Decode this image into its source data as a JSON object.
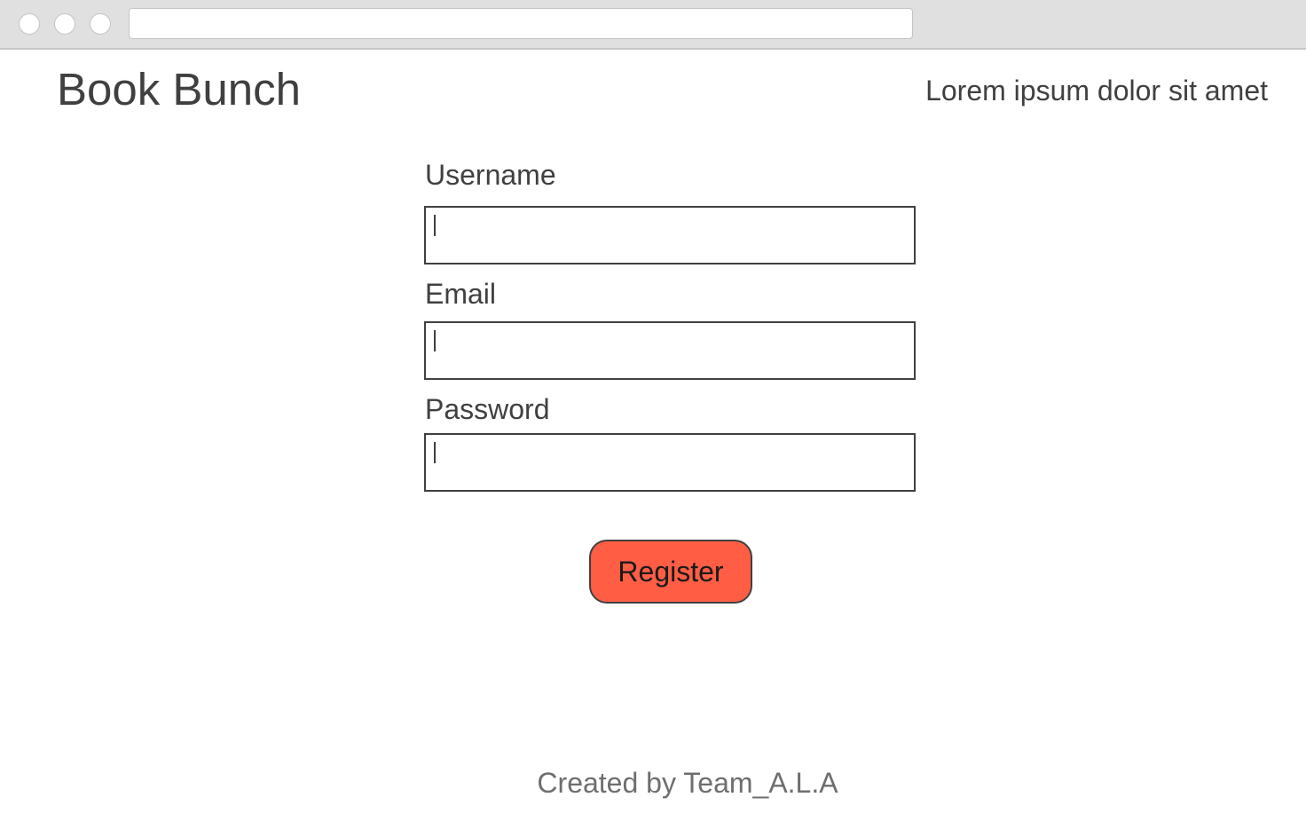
{
  "browser": {
    "address_bar_value": ""
  },
  "header": {
    "title": "Book Bunch",
    "tagline": "Lorem ipsum dolor sit amet"
  },
  "form": {
    "fields": [
      {
        "label": "Username",
        "value": ""
      },
      {
        "label": "Email",
        "value": ""
      },
      {
        "label": "Password",
        "value": ""
      }
    ],
    "submit_label": "Register",
    "submit_color": "#ff5e45"
  },
  "footer": {
    "credit": "Created by Team_A.L.A"
  }
}
